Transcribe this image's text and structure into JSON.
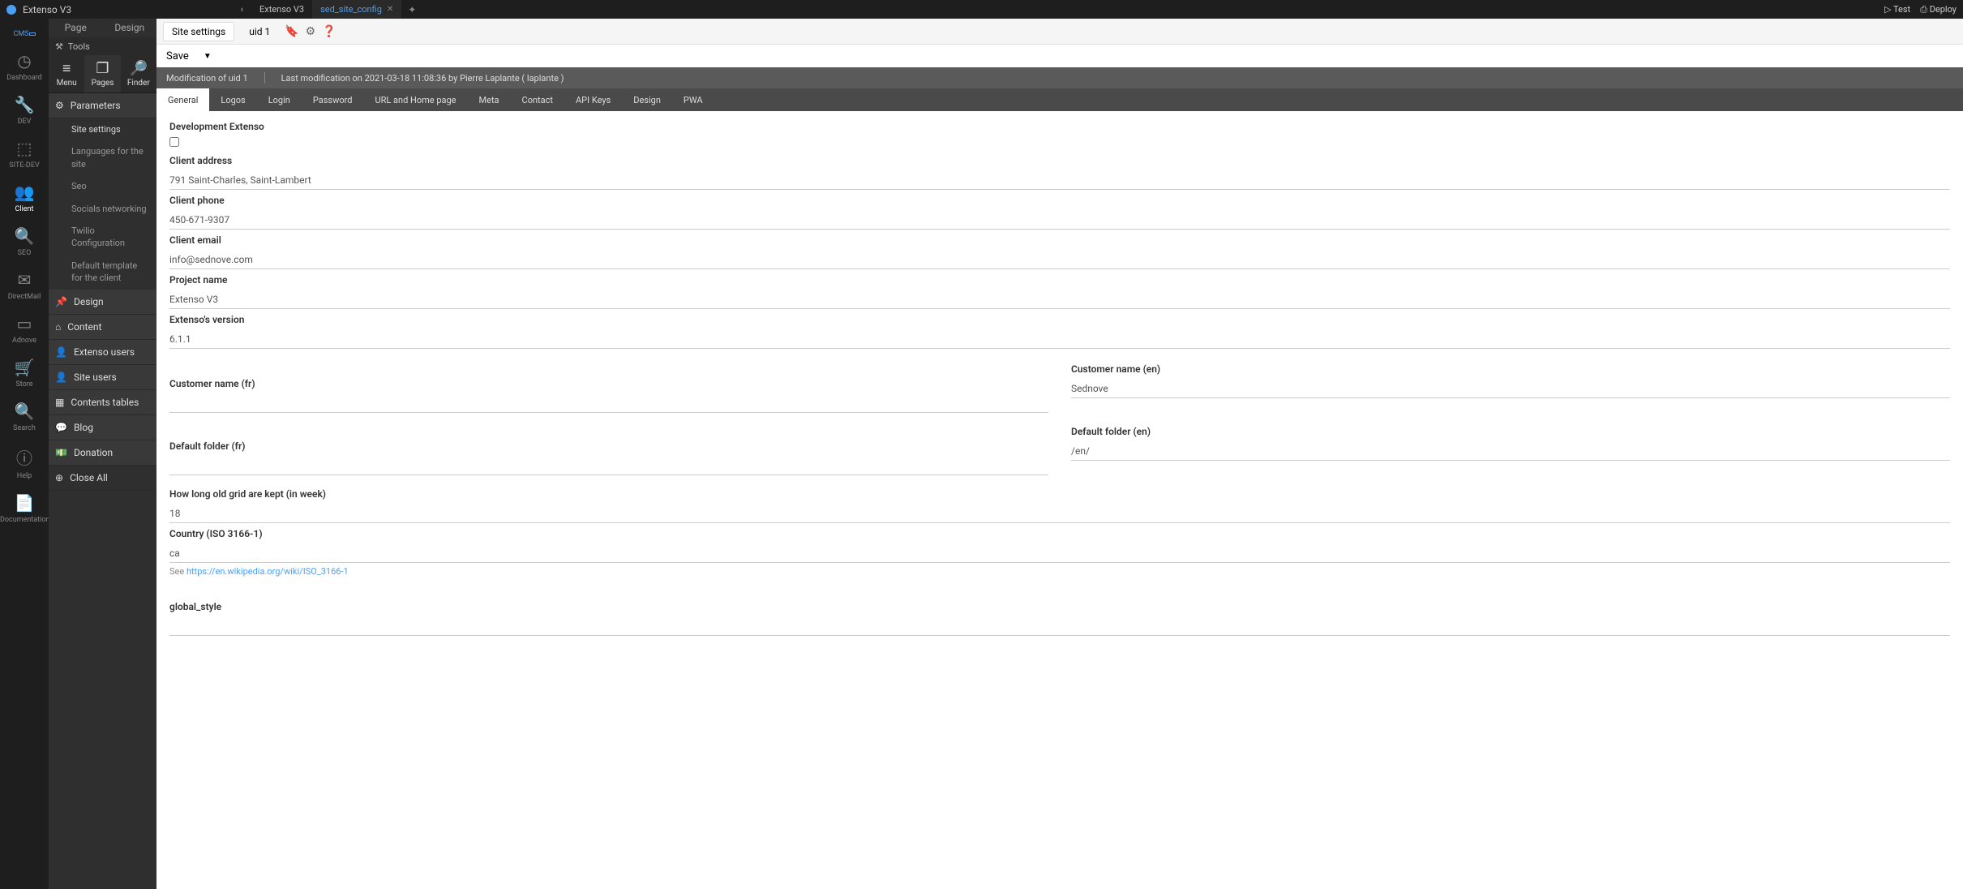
{
  "titlebar": {
    "app": "Extenso V3",
    "test": "Test",
    "deploy": "Deploy"
  },
  "tabs": [
    {
      "label": "Extenso V3",
      "active": false
    },
    {
      "label": "sed_site_config",
      "active": true
    }
  ],
  "rail": [
    {
      "label": "CMS",
      "key": "cms"
    },
    {
      "label": "Dashboard",
      "key": "dashboard"
    },
    {
      "label": "DEV",
      "key": "dev"
    },
    {
      "label": "SITE-DEV",
      "key": "sitedev"
    },
    {
      "label": "Client",
      "key": "client"
    },
    {
      "label": "SEO",
      "key": "seo"
    },
    {
      "label": "DirectMail",
      "key": "directmail"
    },
    {
      "label": "Adnove",
      "key": "adnove"
    },
    {
      "label": "Store",
      "key": "store"
    },
    {
      "label": "Search",
      "key": "search"
    },
    {
      "label": "Help",
      "key": "help"
    },
    {
      "label": "Documentation",
      "key": "documentation"
    }
  ],
  "pageDesign": {
    "page": "Page",
    "design": "Design"
  },
  "tools": "Tools",
  "toolbtns": {
    "menu": "Menu",
    "pages": "Pages",
    "finder": "Finder"
  },
  "accordion": {
    "parameters": "Parameters",
    "design": "Design",
    "content": "Content",
    "extenso_users": "Extenso users",
    "site_users": "Site users",
    "contents_tables": "Contents tables",
    "blog": "Blog",
    "donation": "Donation",
    "close_all": "Close All"
  },
  "params_sub": [
    "Site settings",
    "Languages for the site",
    "Seo",
    "Socials networking",
    "Twilio Configuration",
    "Default template for the client"
  ],
  "breadcrumb": {
    "site_settings": "Site settings",
    "uid": "uid 1"
  },
  "save": "Save",
  "modbar": {
    "left": "Modification of uid 1",
    "right": "Last modification on 2021-03-18 11:08:36 by Pierre Laplante ( laplante )"
  },
  "content_tabs": [
    "General",
    "Logos",
    "Login",
    "Password",
    "URL and Home page",
    "Meta",
    "Contact",
    "API Keys",
    "Design",
    "PWA"
  ],
  "form": {
    "dev_extenso": {
      "label": "Development Extenso"
    },
    "client_address": {
      "label": "Client address",
      "value": "791 Saint-Charles, Saint-Lambert"
    },
    "client_phone": {
      "label": "Client phone",
      "value": "450-671-9307"
    },
    "client_email": {
      "label": "Client email",
      "value": "info@sednove.com"
    },
    "project_name": {
      "label": "Project name",
      "value": "Extenso V3"
    },
    "extenso_version": {
      "label": "Extenso's version",
      "value": "6.1.1"
    },
    "customer_name_fr": {
      "label": "Customer name (fr)",
      "value": ""
    },
    "customer_name_en": {
      "label": "Customer name (en)",
      "value": "Sednove"
    },
    "default_folder_fr": {
      "label": "Default folder (fr)",
      "value": ""
    },
    "default_folder_en": {
      "label": "Default folder (en)",
      "value": "/en/"
    },
    "grid_kept": {
      "label": "How long old grid are kept (in week)",
      "value": "18"
    },
    "country": {
      "label": "Country (ISO 3166-1)",
      "value": "ca",
      "help_prefix": "See ",
      "help_link": "https://en.wikipedia.org/wiki/ISO_3166-1"
    },
    "global_style": {
      "label": "global_style",
      "value": ""
    }
  }
}
